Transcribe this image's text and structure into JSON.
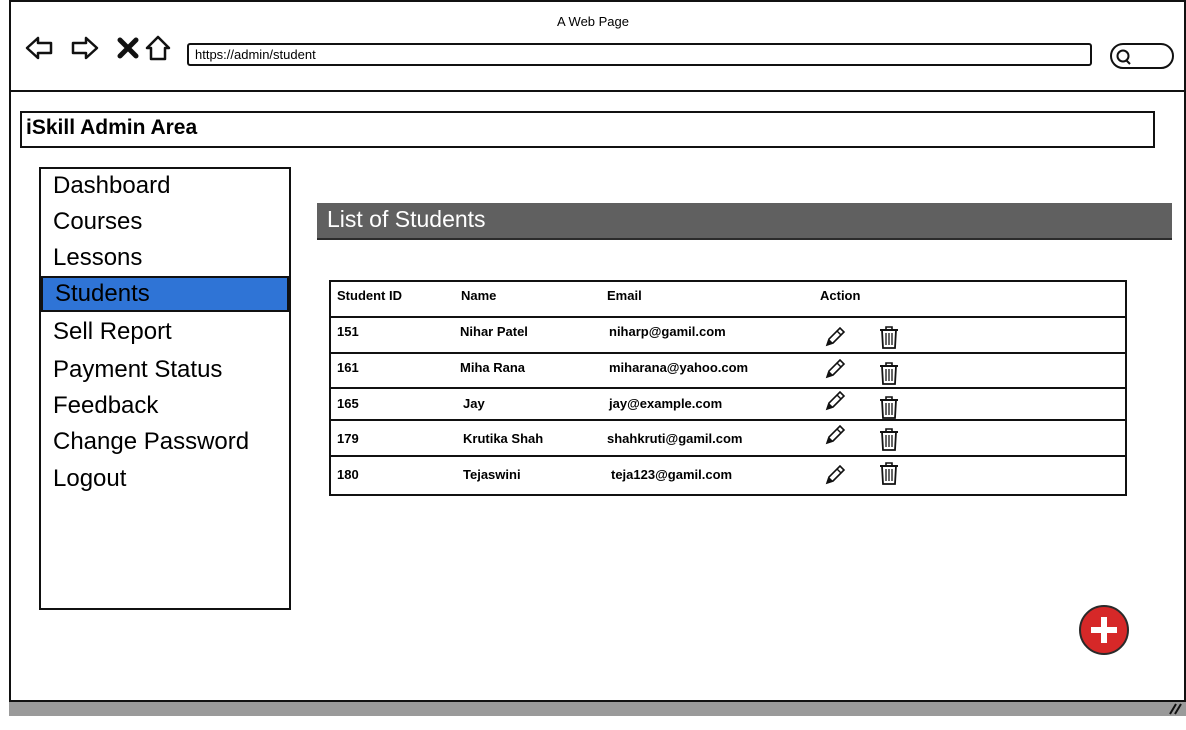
{
  "browser": {
    "window_title": "A Web Page",
    "url": "https://admin/student",
    "nav_icons": [
      "back-arrow-icon",
      "forward-arrow-icon",
      "close-icon",
      "home-icon"
    ],
    "search_icon": "search-icon"
  },
  "app": {
    "title": "iSkill Admin Area"
  },
  "sidebar": {
    "items": [
      {
        "label": "Dashboard",
        "active": false
      },
      {
        "label": "Courses",
        "active": false
      },
      {
        "label": "Lessons",
        "active": false
      },
      {
        "label": "Students",
        "active": true
      },
      {
        "label": "Sell Report",
        "active": false
      },
      {
        "label": "Payment Status",
        "active": false
      },
      {
        "label": "Feedback",
        "active": false
      },
      {
        "label": "Change Password",
        "active": false
      },
      {
        "label": "Logout",
        "active": false
      }
    ],
    "active_color": "#2f74d6"
  },
  "main": {
    "title": "List of Students",
    "table": {
      "headers": [
        "Student ID",
        "Name",
        "Email",
        "Action"
      ],
      "rows": [
        {
          "id": "151",
          "name": "Nihar Patel",
          "email": "niharp@gamil.com"
        },
        {
          "id": "161",
          "name": "Miha Rana",
          "email": "miharana@yahoo.com"
        },
        {
          "id": "165",
          "name": "Jay",
          "email": "jay@example.com"
        },
        {
          "id": "179",
          "name": "Krutika Shah",
          "email": "shahkruti@gamil.com"
        },
        {
          "id": "180",
          "name": "Tejaswini",
          "email": "teja123@gamil.com"
        }
      ],
      "action_icons": [
        "edit-pencil-icon",
        "trash-icon"
      ]
    },
    "add_button_icon": "plus-icon",
    "add_button_color": "#d62828"
  }
}
